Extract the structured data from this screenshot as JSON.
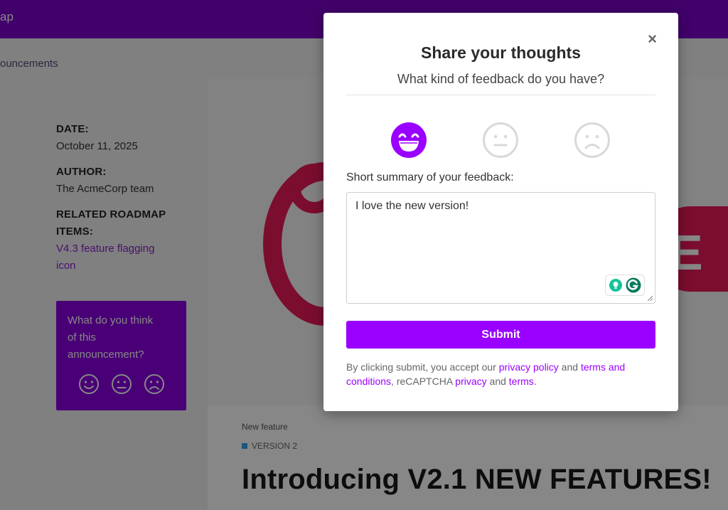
{
  "topbar": {
    "text": "ap"
  },
  "breadcrumb": {
    "text": "ouncements"
  },
  "meta": {
    "date_label": "DATE:",
    "date_value": "October 11, 2025",
    "author_label": "AUTHOR:",
    "author_value": "The AcmeCorp team",
    "related_label_1": "RELATED ROADMAP",
    "related_label_2": "ITEMS:",
    "related_link_1": "V4.3 feature flagging",
    "related_link_2": "icon"
  },
  "side_card": {
    "text_1": "What do you think",
    "text_2": "of this",
    "text_3": "announcement?",
    "faces": [
      "smile-face-icon",
      "neutral-face-icon",
      "sad-face-icon"
    ]
  },
  "hero": {
    "letter": "E"
  },
  "article": {
    "category": "New feature",
    "version": "VERSION 2",
    "title": "Introducing V2.1 NEW FEATURES!"
  },
  "modal": {
    "close": "×",
    "title": "Share your thoughts",
    "subtitle": "What kind of feedback do you have?",
    "faces": [
      {
        "icon": "grinning-face-icon",
        "selected": true
      },
      {
        "icon": "neutral-face-icon",
        "selected": false
      },
      {
        "icon": "sad-face-icon",
        "selected": false
      }
    ],
    "summary_label": "Short summary of your feedback:",
    "summary_value": "I love the new version!",
    "submit_label": "Submit",
    "legal": {
      "prefix": "By clicking submit, you accept our ",
      "privacy_policy": "privacy policy",
      "and1": " and ",
      "terms_and_conditions": "terms and conditions",
      "mid": ", reCAPTCHA ",
      "privacy": "privacy",
      "and2": " and ",
      "terms": "terms",
      "suffix": "."
    }
  },
  "colors": {
    "accent": "#9a00ff",
    "topbar": "#7b00c8",
    "hero_red": "#e8195a",
    "face_inactive": "#d9d9d9"
  }
}
